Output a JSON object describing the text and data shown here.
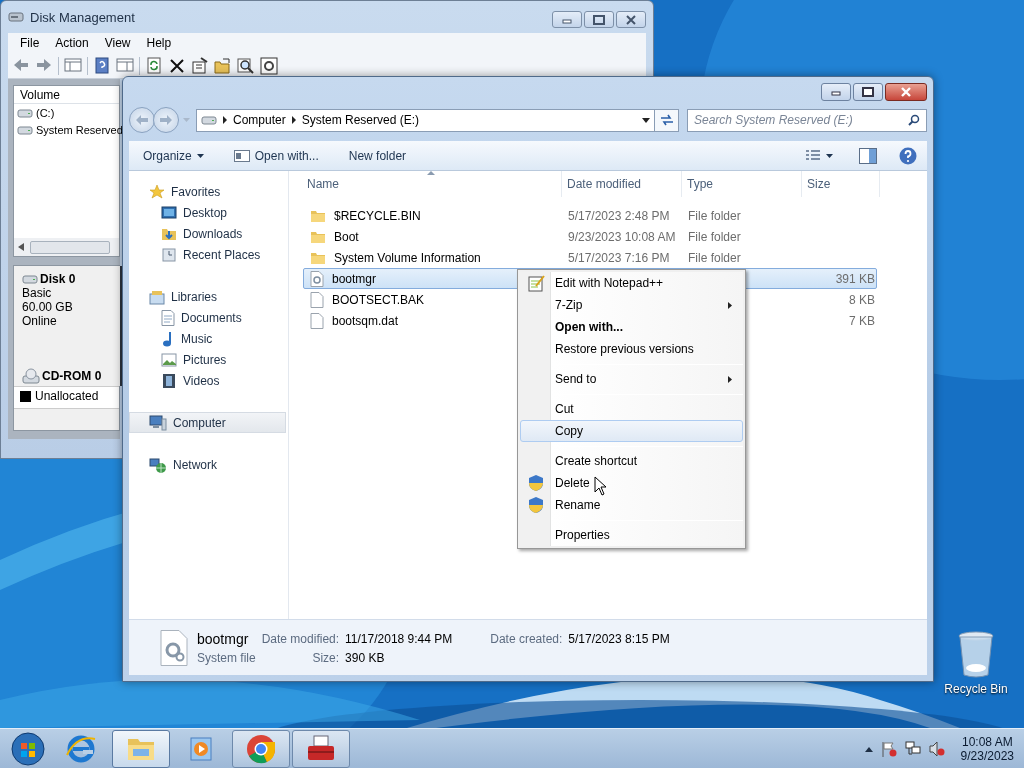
{
  "disk_management": {
    "title": "Disk Management",
    "menu": [
      "File",
      "Action",
      "View",
      "Help"
    ],
    "volume_column": "Volume",
    "volumes": [
      "(C:)",
      "System Reserved"
    ],
    "disks": [
      {
        "name": "Disk 0",
        "lines": [
          "Basic",
          "60.00 GB",
          "Online"
        ]
      },
      {
        "name": "CD-ROM 0"
      }
    ],
    "legend": [
      {
        "label": "Unallocated",
        "color": "#000000"
      }
    ]
  },
  "explorer": {
    "breadcrumb": [
      "Computer",
      "System Reserved (E:)"
    ],
    "search": {
      "placeholder": "Search System Reserved (E:)"
    },
    "toolbar": [
      "Organize",
      "Open with...",
      "New folder"
    ],
    "nav": [
      {
        "label": "Favorites",
        "selected": false,
        "children": [
          {
            "label": "Desktop",
            "selected": false
          },
          {
            "label": "Downloads",
            "selected": false
          },
          {
            "label": "Recent Places",
            "selected": false
          }
        ]
      },
      {
        "label": "Libraries",
        "selected": false,
        "children": [
          {
            "label": "Documents",
            "selected": false
          },
          {
            "label": "Music",
            "selected": false
          },
          {
            "label": "Pictures",
            "selected": false
          },
          {
            "label": "Videos",
            "selected": false
          }
        ]
      },
      {
        "label": "Computer",
        "selected": true
      },
      {
        "label": "Network",
        "selected": false
      }
    ],
    "columns": [
      "Name",
      "Date modified",
      "Type",
      "Size"
    ],
    "rows": [
      {
        "kind": "folder",
        "name": "$RECYCLE.BIN",
        "date": "5/17/2023 2:48 PM",
        "type": "File folder",
        "selected": false
      },
      {
        "kind": "folder",
        "name": "Boot",
        "date": "9/23/2023 10:08 AM",
        "type": "File folder",
        "selected": false
      },
      {
        "kind": "folder",
        "name": "System Volume Information",
        "date": "5/17/2023 7:16 PM",
        "type": "File folder",
        "selected": false
      },
      {
        "kind": "system",
        "name": "bootmgr",
        "size": "391 KB",
        "selected": true
      },
      {
        "kind": "file",
        "name": "BOOTSECT.BAK",
        "size": "8 KB",
        "selected": false
      },
      {
        "kind": "file",
        "name": "bootsqm.dat",
        "size": "7 KB",
        "selected": false
      }
    ],
    "details": {
      "name": "bootmgr",
      "type": "System file",
      "fields": [
        {
          "label": "Date modified:",
          "value": "11/17/2018 9:44 PM"
        },
        {
          "label": "Size:",
          "value": "390 KB"
        },
        {
          "label": "Date created:",
          "value": "5/17/2023 8:15 PM"
        }
      ]
    }
  },
  "context_menu": [
    {
      "kind": "app-item",
      "label": "Edit with Notepad++",
      "bold": false,
      "submenu": false,
      "selected": false
    },
    {
      "kind": "item",
      "label": "7-Zip",
      "bold": false,
      "submenu": true,
      "selected": false
    },
    {
      "kind": "item",
      "label": "Open with...",
      "bold": true,
      "submenu": false,
      "selected": false
    },
    {
      "kind": "item",
      "label": "Restore previous versions",
      "bold": false,
      "submenu": false,
      "selected": false
    },
    {
      "kind": "separator"
    },
    {
      "kind": "item",
      "label": "Send to",
      "bold": false,
      "submenu": true,
      "selected": false
    },
    {
      "kind": "separator"
    },
    {
      "kind": "item",
      "label": "Cut",
      "bold": false,
      "submenu": false,
      "selected": false
    },
    {
      "kind": "item",
      "label": "Copy",
      "bold": false,
      "submenu": false,
      "selected": true
    },
    {
      "kind": "separator"
    },
    {
      "kind": "item",
      "label": "Create shortcut",
      "bold": false,
      "submenu": false,
      "selected": false
    },
    {
      "kind": "admin-item",
      "label": "Delete",
      "bold": false,
      "submenu": false,
      "selected": false
    },
    {
      "kind": "admin-item",
      "label": "Rename",
      "bold": false,
      "submenu": false,
      "selected": false
    },
    {
      "kind": "separator"
    },
    {
      "kind": "item",
      "label": "Properties",
      "bold": false,
      "submenu": false,
      "selected": false
    }
  ],
  "desktop_icons": [
    {
      "label": "Recycle Bin"
    }
  ],
  "taskbar": {
    "apps": [
      {
        "open": false,
        "selected": false
      },
      {
        "open": true,
        "selected": true
      },
      {
        "open": false,
        "selected": false
      },
      {
        "open": true,
        "selected": false
      },
      {
        "open": true,
        "selected": false
      }
    ],
    "time": "10:08 AM",
    "date": "9/23/2023"
  }
}
